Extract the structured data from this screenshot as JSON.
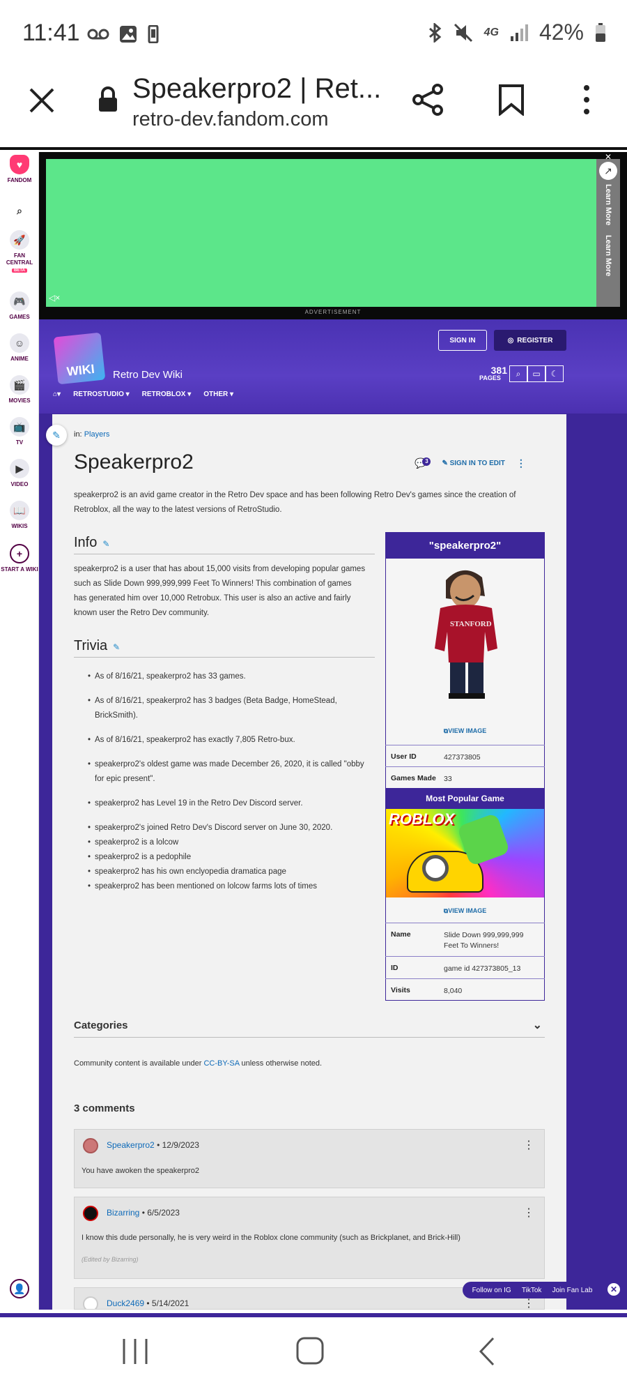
{
  "status_bar": {
    "time": "11:41",
    "battery": "42%"
  },
  "browser": {
    "page_title": "Speakerpro2 | Ret...",
    "url": "retro-dev.fandom.com"
  },
  "rail": {
    "items": [
      "FANDOM",
      "FAN CENTRAL",
      "BETA",
      "GAMES",
      "ANIME",
      "MOVIES",
      "TV",
      "VIDEO",
      "WIKIS",
      "START A WIKI"
    ]
  },
  "ad": {
    "label": "ADVERTISEMENT",
    "learn_more": "Learn More"
  },
  "wiki": {
    "name": "Retro Dev Wiki",
    "logo_text": "WIKI",
    "sign_in": "SIGN IN",
    "register": "REGISTER",
    "pages_count": "381",
    "pages_label": "PAGES",
    "nav": [
      "RETROSTUDIO ▾",
      "RETROBLOX ▾",
      "OTHER ▾"
    ]
  },
  "article": {
    "in_label": "in:",
    "category_link": "Players",
    "title": "Speakerpro2",
    "comment_badge": "3",
    "sign_in_to_edit": "SIGN IN TO EDIT",
    "intro": "speakerpro2 is an avid game creator in the Retro Dev space and has been following Retro Dev's games since the creation of Retroblox, all the way to the latest versions of RetroStudio.",
    "info_heading": "Info",
    "info_text": "speakerpro2 is a user that has about 15,000 visits from developing popular games such as Slide Down 999,999,999 Feet To Winners! This combination of games has generated him over 10,000 Retrobux. This user is also an active and fairly known user the Retro Dev community.",
    "trivia_heading": "Trivia",
    "trivia": [
      "As of 8/16/21, speakerpro2 has 33 games.",
      "As of 8/16/21, speakerpro2 has 3 badges (Beta Badge, HomeStead, BrickSmith).",
      "As of 8/16/21, speakerpro2 has exactly 7,805 Retro-bux.",
      "speakerpro2's oldest game was made December 26, 2020, it is called \"obby for epic present\".",
      "speakerpro2 has Level 19 in the Retro Dev Discord server.",
      "speakerpro2's joined Retro Dev's Discord server on June 30, 2020.",
      "speakerpro2 is a lolcow",
      "speakerpro2 is a pedophile",
      "speakerpro2 has his own enclyopedia dramatica page",
      "speakerpro2 has been mentioned on lolcow farms lots of times"
    ]
  },
  "infobox": {
    "title": "\"speakerpro2\"",
    "view_image": "VIEW IMAGE",
    "avatar_shirt_text": "STANFORD",
    "rows": [
      {
        "k": "User ID",
        "v": "427373805"
      },
      {
        "k": "Games Made",
        "v": "33"
      }
    ],
    "popular_heading": "Most Popular Game",
    "game_logo": "ROBLOX",
    "game_rows": [
      {
        "k": "Name",
        "v": "Slide Down 999,999,999 Feet To Winners!"
      },
      {
        "k": "ID",
        "v": "game id 427373805_13"
      },
      {
        "k": "Visits",
        "v": "8,040"
      }
    ]
  },
  "categories": {
    "label": "Categories"
  },
  "license": {
    "pre": "Community content is available under ",
    "link": "CC-BY-SA",
    "post": " unless otherwise noted."
  },
  "comments": {
    "count_label": "3 comments",
    "items": [
      {
        "user": "Speakerpro2",
        "date": "• 12/9/2023",
        "text": "You have awoken the speakerpro2",
        "edited": ""
      },
      {
        "user": "Bizarring",
        "date": "• 6/5/2023",
        "text": "I know this dude personally, he is very weird in the Roblox clone community (such as Brickplanet, and Brick-Hill)",
        "edited": "(Edited by Bizarring)"
      },
      {
        "user": "Duck2469",
        "date": "• 5/14/2021",
        "text": "",
        "edited": ""
      }
    ]
  },
  "footer": {
    "links": [
      "Follow on IG",
      "TikTok",
      "Join Fan Lab"
    ]
  },
  "colors": {
    "purple": "#3d2699",
    "ad_green": "#5ce68a",
    "link": "#0e6ab8"
  }
}
